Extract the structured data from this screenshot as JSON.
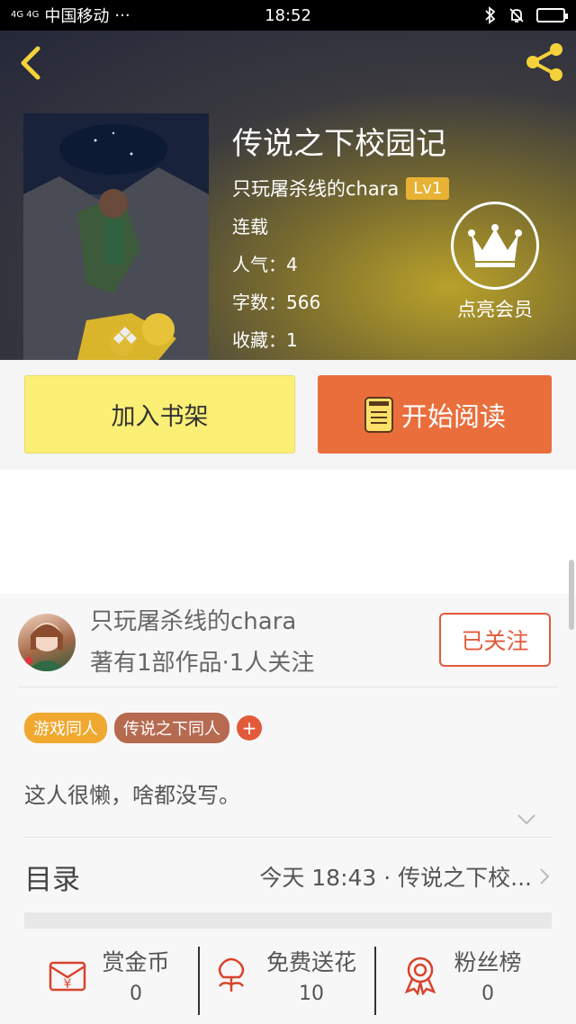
{
  "status_bar": {
    "carrier": "中国移动",
    "dots": "···",
    "signal": "4G 4G",
    "time": "18:52"
  },
  "book": {
    "title": "传说之下校园记",
    "author": "只玩屠杀线的chara",
    "level": "Lv1",
    "status": "连载",
    "popularity": "人气：4",
    "word_count": "字数：566",
    "favorites": "收藏：1"
  },
  "vip": {
    "label": "点亮会员"
  },
  "actions": {
    "add_shelf": "加入书架",
    "start_read": "开始阅读"
  },
  "author_panel": {
    "name": "只玩屠杀线的chara",
    "meta": "著有1部作品·1人关注",
    "follow": "已关注",
    "tags": [
      "游戏同人",
      "传说之下同人"
    ],
    "add_tag": "+",
    "intro": "这人很懒，啥都没写。"
  },
  "toc": {
    "label": "目录",
    "latest": "今天 18:43 · 传说之下校..."
  },
  "stats": [
    {
      "label": "赏金币",
      "value": "0"
    },
    {
      "label": "免费送花",
      "value": "10"
    },
    {
      "label": "粉丝榜",
      "value": "0"
    }
  ],
  "colors": {
    "accent": "#ea6e3c",
    "shelf_button": "#fbef76",
    "level_badge": "#e8b234",
    "follow": "#e35a3b"
  }
}
